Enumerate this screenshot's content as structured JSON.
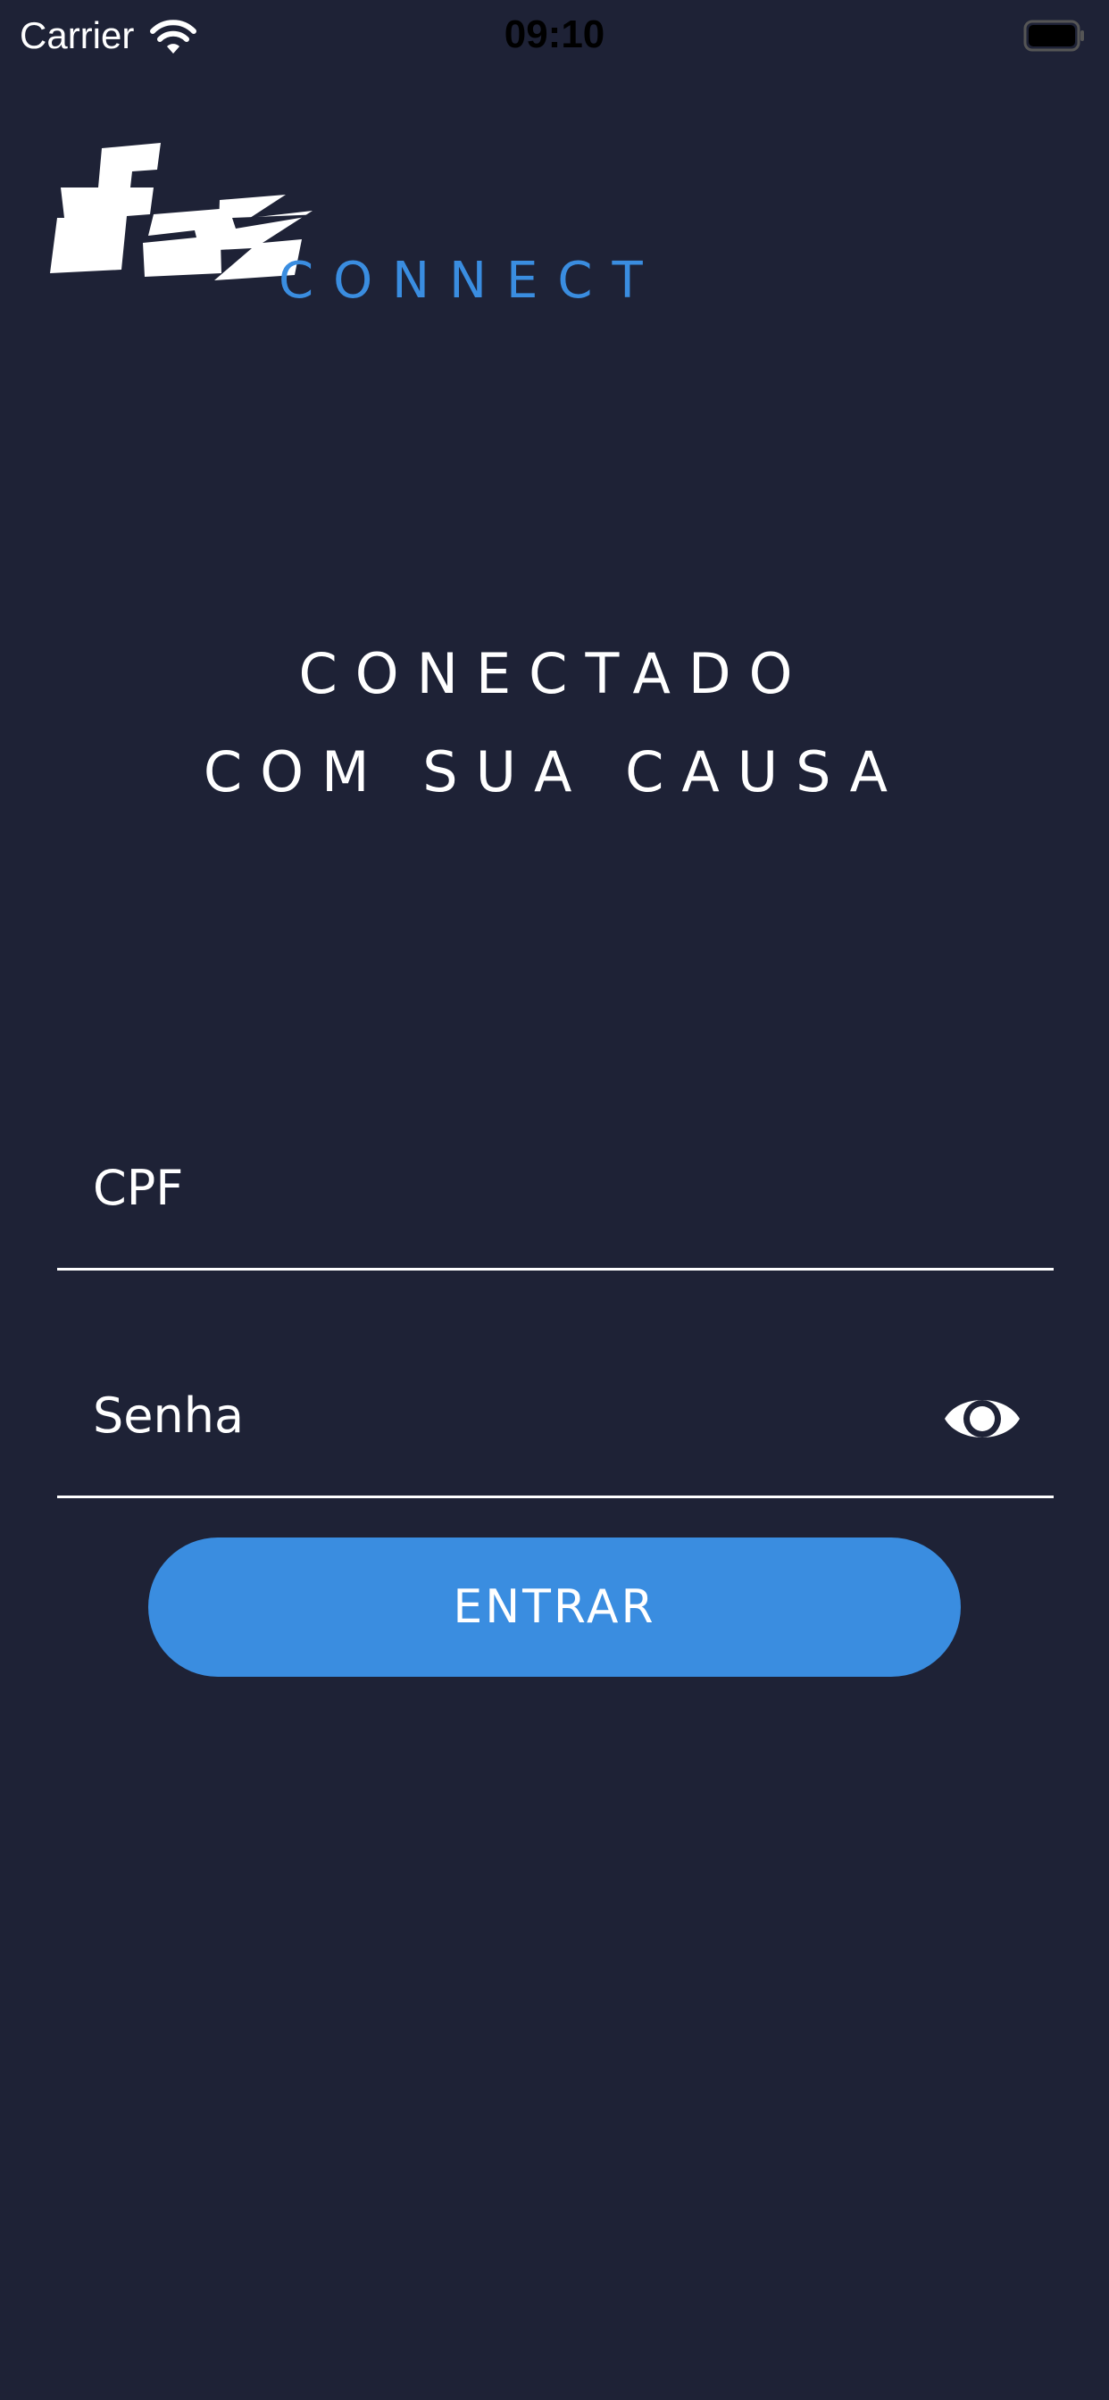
{
  "status_bar": {
    "carrier": "Carrier",
    "time": "09:10",
    "wifi_icon": "wifi-icon",
    "battery_icon": "battery-icon"
  },
  "logo": {
    "wordmark": "faz",
    "subtitle": "CONNECT",
    "accent_color": "#3a8de0"
  },
  "tagline": {
    "line1": "CONECTADO",
    "line2": "COM SUA CAUSA"
  },
  "form": {
    "cpf": {
      "placeholder": "CPF",
      "value": ""
    },
    "senha": {
      "placeholder": "Senha",
      "value": "",
      "toggle_icon": "eye-icon"
    },
    "submit_label": "ENTRAR"
  },
  "colors": {
    "background": "#1e2236",
    "button": "#3a8de0",
    "text": "#ffffff"
  }
}
